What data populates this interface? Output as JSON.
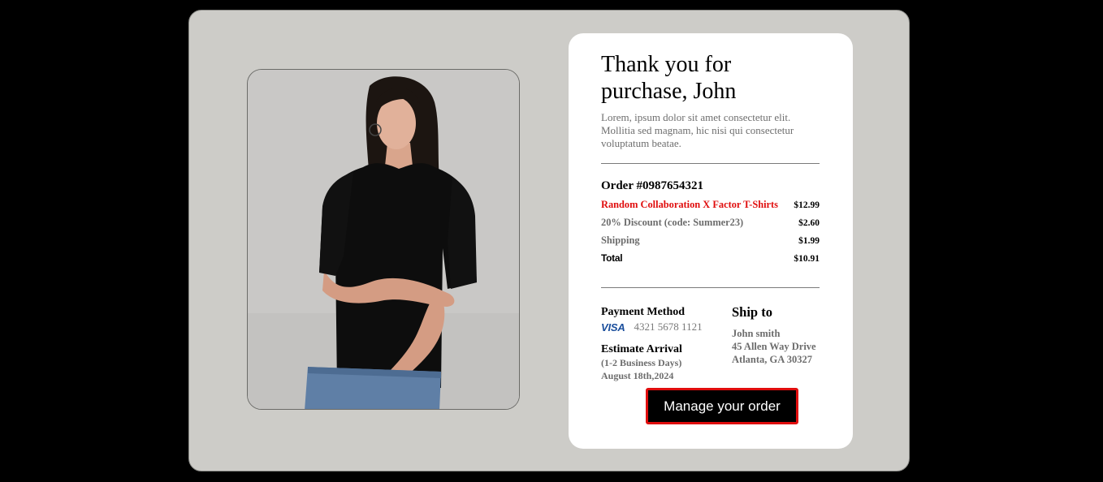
{
  "photo": {
    "alt": "Model wearing black oversized T-shirt"
  },
  "card": {
    "title": "Thank you for purchase, John",
    "lead": "Lorem, ipsum dolor sit amet consectetur elit. Mollitia sed magnam, hic nisi qui consectetur voluptatum beatae.",
    "order_title": "Order #0987654321",
    "lines": [
      {
        "name": "Random Collaboration X Factor T-Shirts",
        "amount": "$12.99"
      },
      {
        "name": "20% Discount (code: Summer23)",
        "amount": "$2.60"
      },
      {
        "name": "Shipping",
        "amount": "$1.99"
      },
      {
        "name": "Total",
        "amount": "$10.91"
      }
    ],
    "payment": {
      "heading": "Payment Method",
      "brand": "VISA",
      "number": "4321 5678 1121"
    },
    "arrival": {
      "heading": "Estimate Arrival",
      "range": "(1-2 Business Days)",
      "date": "August 18th,2024"
    },
    "ship": {
      "heading": "Ship to",
      "name": "John smith",
      "street": "45 Allen Way Drive",
      "city": "Atlanta, GA 30327"
    },
    "cta_label": "Manage your order"
  },
  "colors": {
    "accent_red": "#e00d0d",
    "visa_blue": "#1a4e9c",
    "stage_bg": "#cdccc8"
  }
}
